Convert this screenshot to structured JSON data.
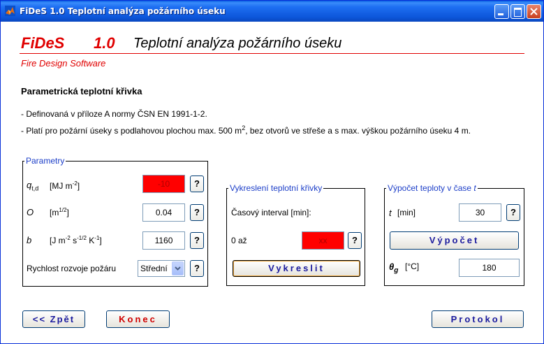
{
  "window": {
    "title": "FiDeS 1.0 Teplotní analýza požárního úseku"
  },
  "header": {
    "app_name": "FiDeS",
    "version": "1.0",
    "heading": "Teplotní analýza požárního úseku",
    "subtitle": "Fire Design Software"
  },
  "section": {
    "title": "Parametrická teplotní křivka",
    "note1": "- Definovaná v příloze A normy ČSN EN 1991-1-2.",
    "note2_before": "- Platí pro požární úseky s podlahovou plochou max. 500 m",
    "note2_sup": "2",
    "note2_after": ", bez otvorů ve střeše a s max. výškou požárního úseku 4 m."
  },
  "parametry": {
    "legend": "Parametry",
    "q": {
      "symbol": "q",
      "sub": "t,d",
      "unit_open": "[MJ m",
      "unit_exp": "-2",
      "unit_close": "]",
      "value": "-10"
    },
    "o": {
      "symbol": "O",
      "unit_open": "[m",
      "unit_exp": "1/2",
      "unit_close": "]",
      "value": "0.04"
    },
    "b": {
      "symbol": "b",
      "unit_a": "[J m",
      "exp_a": "-2",
      "unit_b": " s",
      "exp_b": "-1/2",
      "unit_c": " K",
      "exp_c": "-1",
      "unit_close": "]",
      "value": "1160"
    },
    "rychlost": {
      "label": "Rychlost rozvoje požáru",
      "value": "Střední"
    },
    "help": "?"
  },
  "vykresleni": {
    "legend": "Vykreslení teplotní křivky",
    "interval_label": "Časový interval  [min]:",
    "from_label": "0 až",
    "to_value": "xx",
    "button": "Vykreslit",
    "help": "?"
  },
  "vypocet": {
    "legend_text": "Výpočet teploty v čase ",
    "legend_var": "t",
    "t_symbol": "t",
    "t_unit": "[min]",
    "t_value": "30",
    "button": "Výpočet",
    "theta_symbol": "θ",
    "theta_sub": "g",
    "theta_unit": "[°C]",
    "theta_value": "180",
    "help": "?"
  },
  "footer": {
    "back": "<< Zpět",
    "end": "Konec",
    "protocol": "Protokol"
  },
  "colors": {
    "accent_red": "#e00000",
    "error_field": "#ff0000",
    "legend_blue": "#1c3ec8",
    "titlebar_blue": "#0c55d9"
  },
  "icons": [
    "matlab-logo-icon",
    "minimize-icon",
    "maximize-icon",
    "close-icon",
    "chevron-down-icon"
  ]
}
